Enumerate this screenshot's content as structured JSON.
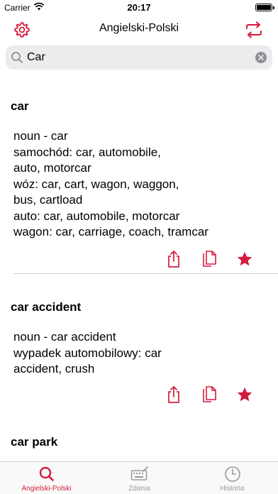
{
  "status_bar": {
    "carrier": "Carrier",
    "time": "20:17"
  },
  "nav": {
    "title": "Angielski-Polski"
  },
  "search": {
    "value": "Car",
    "placeholder": ""
  },
  "results": [
    {
      "word": "car",
      "lines": [
        "noun - car",
        "samochód: car, automobile,",
        "auto, motorcar",
        "wóz: car, cart, wagon, waggon,",
        "bus, cartload",
        "auto: car, automobile, motorcar",
        "wagon: car, carriage, coach, tramcar"
      ],
      "favorited": true
    },
    {
      "word": "car accident",
      "lines": [
        "noun - car accident",
        "wypadek automobilowy: car",
        "accident, crush"
      ],
      "favorited": true
    },
    {
      "word": "car park",
      "lines": [],
      "favorited": false
    }
  ],
  "tabs": [
    {
      "label": "Angielski-Polski",
      "icon": "search-icon",
      "active": true
    },
    {
      "label": "Zdania",
      "icon": "keyboard-icon",
      "active": false
    },
    {
      "label": "Historia",
      "icon": "clock-icon",
      "active": false
    }
  ],
  "colors": {
    "accent": "#d41a3c",
    "inactive": "#999999",
    "search_bg": "#ececee"
  }
}
